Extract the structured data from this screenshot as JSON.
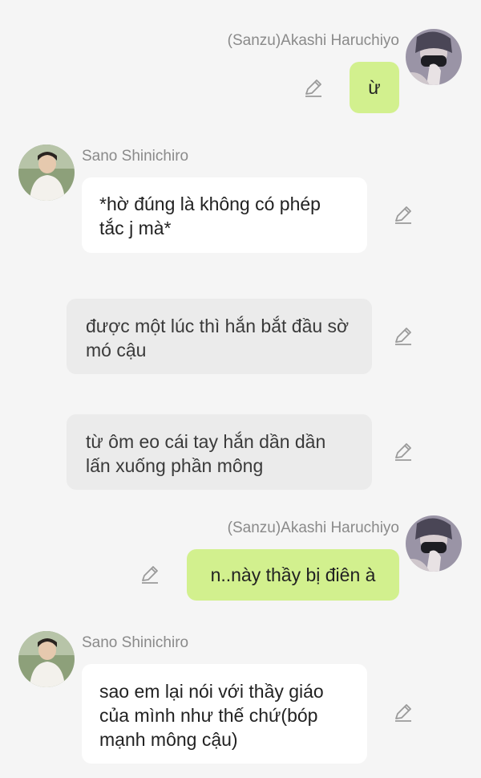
{
  "messages": [
    {
      "sender": "(Sanzu)Akashi Haruchiyo",
      "text": "ừ"
    },
    {
      "sender": "Sano Shinichiro",
      "text": "*hờ đúng là không có phép tắc j mà*"
    },
    {
      "text": "được một lúc thì hắn bắt đầu sờ mó cậu"
    },
    {
      "text": "từ ôm eo cái tay hắn dần dần lấn xuống phần mông"
    },
    {
      "sender": "(Sanzu)Akashi Haruchiyo",
      "text": "n..này thầy bị điên à"
    },
    {
      "sender": "Sano Shinichiro",
      "text": "sao em lại nói với thầy giáo của mình như thế chứ(bóp mạnh mông cậu)"
    }
  ],
  "colors": {
    "background": "#f5f5f5",
    "my_bubble": "#d2f08e",
    "their_bubble": "#ffffff",
    "narration_bubble": "#ebebeb",
    "name_text": "#8a8a8a"
  },
  "icons": {
    "edit": "pencil-icon",
    "avatar_sanzu": "masked-person-avatar",
    "avatar_shinichiro": "person-outdoor-avatar"
  }
}
